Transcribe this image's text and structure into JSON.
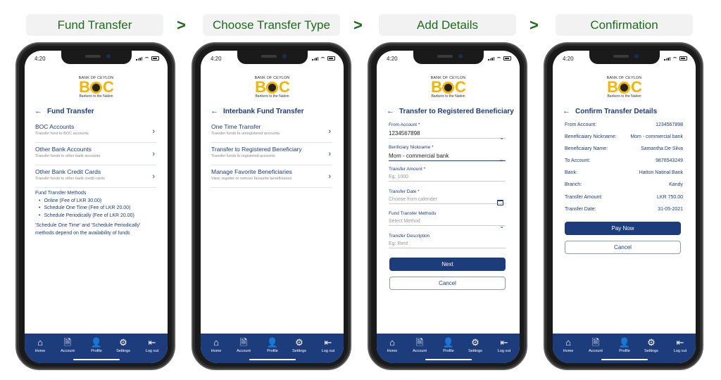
{
  "steps": [
    {
      "label": "Fund Transfer"
    },
    {
      "label": "Choose Transfer Type"
    },
    {
      "label": "Add Details"
    },
    {
      "label": "Confirmation"
    }
  ],
  "step_separator": ">",
  "status_time": "4:20",
  "logo": {
    "top": "BANK OF CEYLON",
    "b": "B",
    "c": "C",
    "sub": "Bankers to the Nation"
  },
  "back_glyph": "←",
  "chevron_glyph": "›",
  "tabbar": [
    {
      "label": "Home",
      "icon": "home-icon",
      "glyph": "⌂"
    },
    {
      "label": "Account",
      "icon": "account-statement-icon",
      "glyph": "🗎"
    },
    {
      "label": "Profile",
      "icon": "profile-icon",
      "glyph": "👤"
    },
    {
      "label": "Settings",
      "icon": "gear-icon",
      "glyph": "⚙"
    },
    {
      "label": "Log out",
      "icon": "logout-icon",
      "glyph": "⇤"
    }
  ],
  "screen1": {
    "title": "Fund Transfer",
    "items": [
      {
        "title": "BOC Accounts",
        "subtitle": "Transfer fund to BOC accounts"
      },
      {
        "title": "Other Bank Accounts",
        "subtitle": "Transfer funds to other bank accounts"
      },
      {
        "title": "Other Bank Credit Cards",
        "subtitle": "Transfer funds to other bank credit cards"
      }
    ],
    "methods_heading": "Fund Transfer Methods",
    "methods": [
      "Online (Fee of LKR 30.00)",
      "Schedule One Time (Fee of LKR 20.00)",
      "Schedule Periodically (Fee of LKR 20.00)"
    ],
    "note": "'Schedule One Time' and 'Schedule Periodically' methods depend on the availability of funds"
  },
  "screen2": {
    "title": "Interbank Fund Transfer",
    "items": [
      {
        "title": "One Time Transfer",
        "subtitle": "Transfer funds to unregistered accounts"
      },
      {
        "title": "Transfer to Registered Beneficiary",
        "subtitle": "Transfer funds to registered accounts"
      },
      {
        "title": "Manage Favorite Beneficiaries",
        "subtitle": "View, register or remove favourite beneficiaries"
      }
    ]
  },
  "screen3": {
    "title": "Transfer to Registered Beneficiary",
    "fields": [
      {
        "label": "From Account *",
        "value": "1234567898",
        "placeholder": "",
        "type": "dropdown"
      },
      {
        "label": "Benficiary Nickname *",
        "value": "Mom - commercial bank",
        "placeholder": "",
        "type": "dropdown"
      },
      {
        "label": "Transfer Amount *",
        "value": "",
        "placeholder": "Eg: 1000",
        "type": "text"
      },
      {
        "label": "Transfer Date *",
        "value": "",
        "placeholder": "Choose from calender",
        "type": "date"
      },
      {
        "label": "Fund Transfer Methods",
        "value": "",
        "placeholder": "Select Method",
        "type": "dropdown"
      },
      {
        "label": "Transfer Description",
        "value": "",
        "placeholder": "Eg: Rent",
        "type": "text"
      }
    ],
    "next_label": "Next",
    "cancel_label": "Cancel"
  },
  "screen4": {
    "title": "Confirm Transfer Details",
    "rows": [
      {
        "label": "From Account:",
        "value": "1234567898"
      },
      {
        "label": "Beneficaiary Nickname:",
        "value": "Mom - commercial bank"
      },
      {
        "label": "Beneficaiary Name:",
        "value": "Samantha De Silva"
      },
      {
        "label": "To Account:",
        "value": "9876543249"
      },
      {
        "label": "Bank:",
        "value": "Hatton Natinal Bank"
      },
      {
        "label": "Branch:",
        "value": "Kandy"
      },
      {
        "label": "Transfer Amount:",
        "value": "LKR 750.00"
      },
      {
        "label": "Transfer Date:",
        "value": "31-05-2021"
      }
    ],
    "pay_label": "Pay Now",
    "cancel_label": "Cancel"
  },
  "colors": {
    "primary": "#1c3c7c",
    "step_text": "#1e6b1e",
    "step_bg": "#f2f2f2",
    "logo_yellow": "#f4b400"
  }
}
